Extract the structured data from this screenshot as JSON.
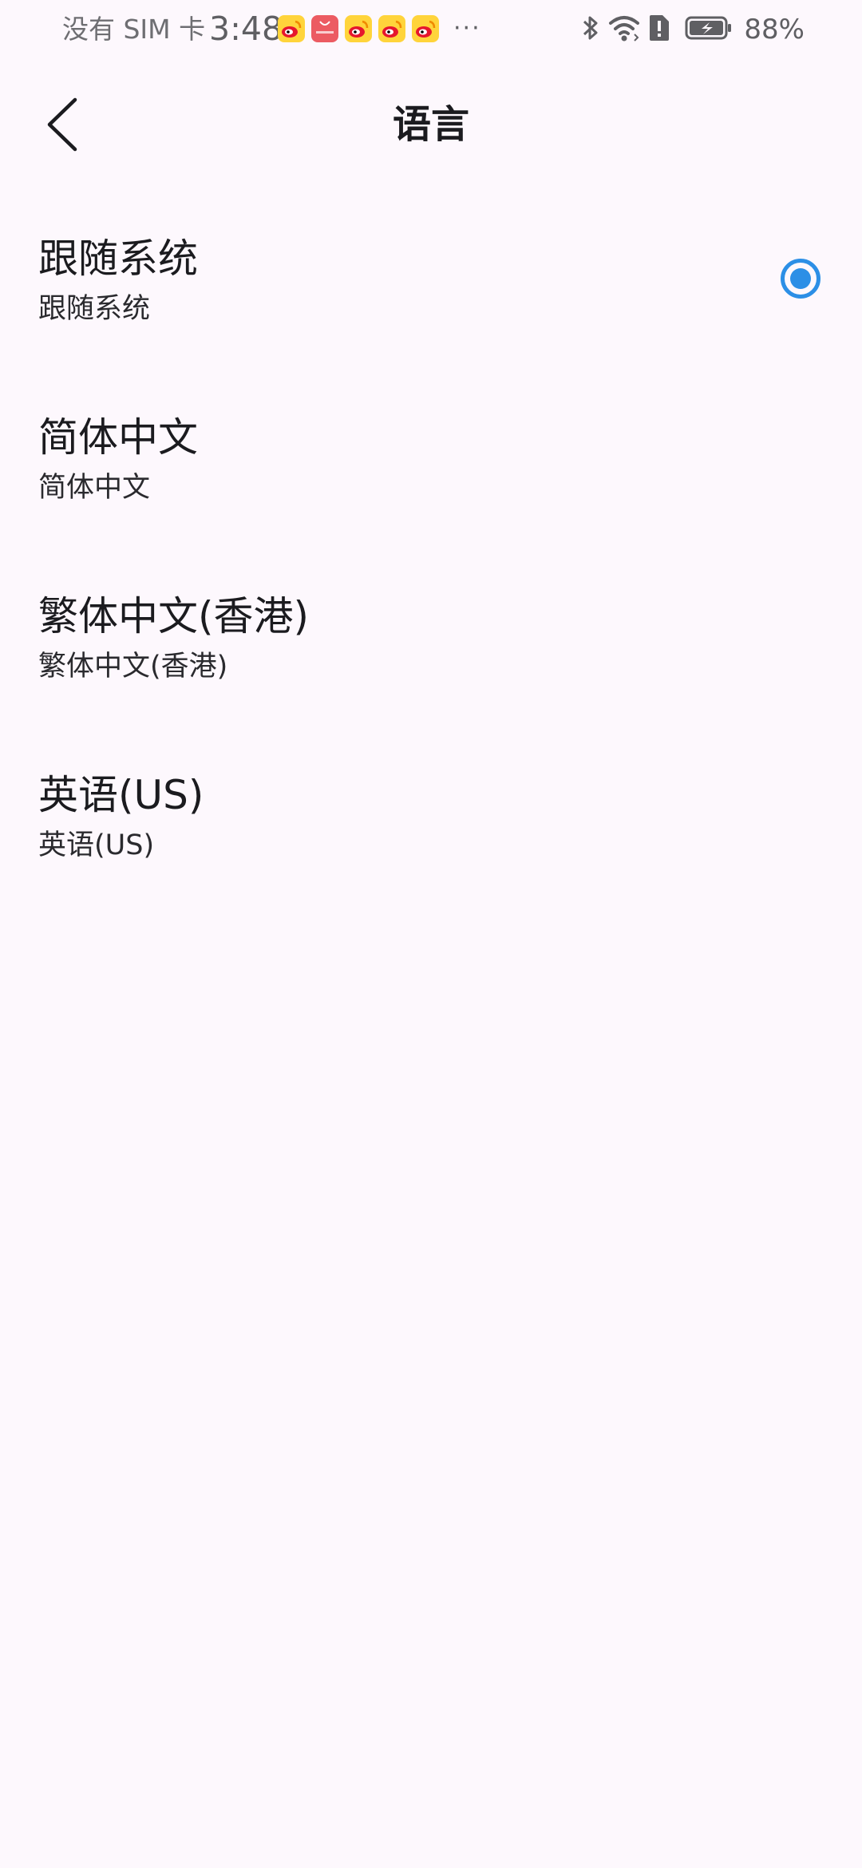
{
  "status_bar": {
    "carrier": "没有 SIM 卡",
    "time": "3:48",
    "app_icons": [
      "weibo-icon",
      "huawei-appgallery-icon",
      "weibo-icon",
      "weibo-icon",
      "weibo-icon"
    ],
    "more": "···",
    "battery_percent": "88%"
  },
  "app_bar": {
    "title": "语言",
    "back_icon": "chevron-left-icon"
  },
  "languages": [
    {
      "title": "跟随系统",
      "subtitle": "跟随系统",
      "selected": true
    },
    {
      "title": "简体中文",
      "subtitle": "简体中文",
      "selected": false
    },
    {
      "title": "繁体中文(香港)",
      "subtitle": "繁体中文(香港)",
      "selected": false
    },
    {
      "title": "英语(US)",
      "subtitle": "英语(US)",
      "selected": false
    }
  ],
  "colors": {
    "background": "#fdf8fd",
    "accent": "#2c8fe6",
    "text": "#1b1b1f"
  }
}
